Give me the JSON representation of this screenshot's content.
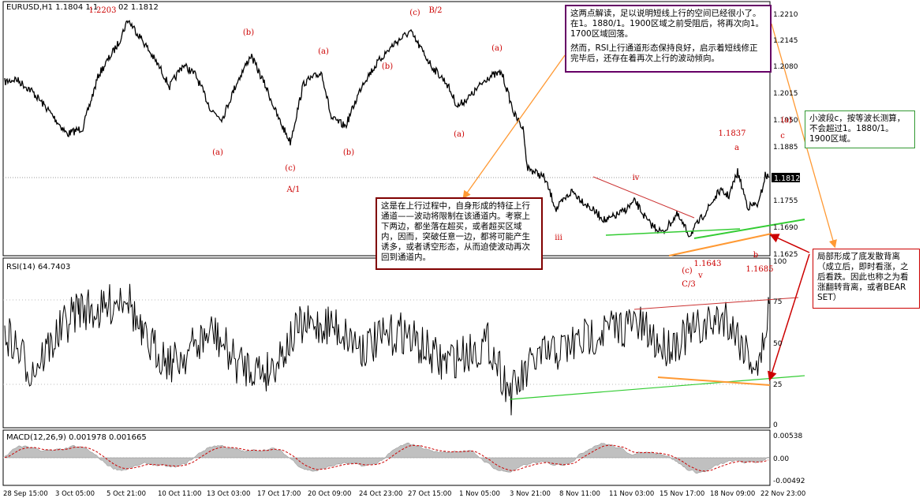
{
  "chart_data": [
    {
      "type": "candlestick",
      "title": "EURUSD,H1  1.1804 1.1",
      "title_tail": "02 1.1812",
      "y_ticks": [
        "1.2210",
        "1.2145",
        "1.2080",
        "1.2015",
        "1.1950",
        "1.1885",
        "1.1820",
        "1.1755",
        "1.1690",
        "1.1625"
      ],
      "current_price": "1.1812",
      "wave_labels": {
        "high_1": "1.2203",
        "c_top": "(c)",
        "b2": "B/2",
        "b_1": "(b)",
        "a_1": "(a)",
        "b_2": "(b)",
        "a_2": "(a)",
        "a_3": "(a)",
        "c_1": "(c)",
        "b_3": "(b)",
        "a_4": "(a)",
        "a1": "A/1",
        "iv": "iv",
        "iii": "iii",
        "c_2": "(c)",
        "c3": "C/3",
        "v": "v",
        "low": "1.1643",
        "high_2": "1.1837",
        "a_small": "a",
        "b_small": "b",
        "low_b": "1.1685",
        "a_right": "(a)",
        "c_right": "c"
      }
    },
    {
      "type": "line",
      "title": "RSI(14)  64.7403",
      "y_ticks": [
        "100",
        "75",
        "50",
        "25",
        "0"
      ]
    },
    {
      "type": "histogram",
      "title": "MACD(12,26,9)  0.001978  0.001665",
      "y_ticks": [
        "0.00538",
        "0.00",
        "-0.00492"
      ]
    }
  ],
  "x_ticks": [
    "28 Sep 15:00",
    "3 Oct 05:00",
    "5 Oct 21:00",
    "10 Oct 11:00",
    "13 Oct 03:00",
    "17 Oct 17:00",
    "20 Oct 09:00",
    "24 Oct 23:00",
    "27 Oct 15:00",
    "1 Nov 05:00",
    "3 Nov 21:00",
    "8 Nov 11:00",
    "11 Nov 03:00",
    "15 Nov 17:00",
    "18 Nov 09:00",
    "22 Nov 23:00"
  ],
  "callouts": {
    "top": {
      "p1": "这两点解读，足以说明短线上行的空间已经很小了。在1。1880/1。1900区域之前受阻后，将再次向1。1700区域回落。",
      "p2": "然而，RSI上行通道形态保持良好，启示着短线修正完毕后，还存在着再次上行的波动倾向。"
    },
    "mid": "这是在上行过程中，自身形成的特征上行通道——波动将限制在该通道内。考察上下两边，都坐落在超买，或者超买区域内，因而，突破任意一边，都将可能产生诱多，或者诱空形态，从而迫使波动再次回到通道内。",
    "green": "小波段c，按等波长测算，不会超过1。1880/1。1900区域。",
    "red": "局部形成了底发散背离（成立后，即时看涨，之后看跌。因此也称之为看涨翻转背离，或者BEAR SET）"
  },
  "colors": {
    "price": "#000000",
    "label_red": "#cc0000",
    "green_line": "#33cc33",
    "orange_line": "#ff9933",
    "red_line": "#cc3333",
    "callout_top_border": "#660066",
    "callout_mid_border": "#800000",
    "callout_green_border": "#339933",
    "callout_red_border": "#cc0000",
    "macd_hist": "#c0c0c0",
    "macd_signal": "#cc0000"
  }
}
